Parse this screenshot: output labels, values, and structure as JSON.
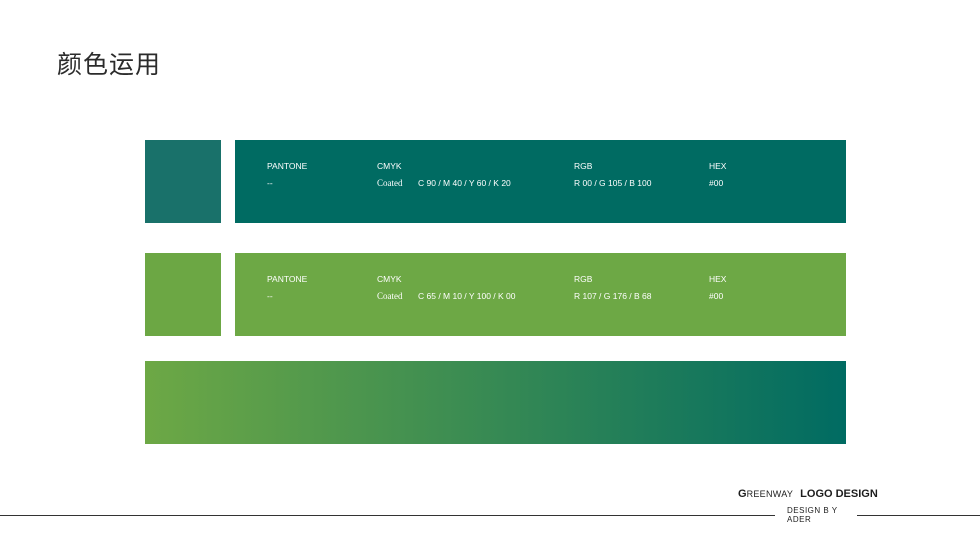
{
  "title": "颜色运用",
  "colors": {
    "teal": "#006B62",
    "teal_swatch": "#19716A",
    "green": "#6DA845",
    "green_swatch": "#6CA744"
  },
  "swatches": [
    {
      "pantone_label": "PANTONE",
      "pantone_value": "--",
      "cmyk_label": "CMYK",
      "cmyk_coated": "Coated",
      "cmyk_value": "C 90 / M 40 / Y 60 / K 20",
      "rgb_label": "RGB",
      "rgb_value": "R 00 / G 105 / B 100",
      "hex_label": "HEX",
      "hex_value": "#00"
    },
    {
      "pantone_label": "PANTONE",
      "pantone_value": "--",
      "cmyk_label": "CMYK",
      "cmyk_coated": "Coated",
      "cmyk_value": "C 65 / M 10 / Y 100 / K 00",
      "rgb_label": "RGB",
      "rgb_value": "R 107 / G 176 / B 68",
      "hex_label": "HEX",
      "hex_value": "#00"
    }
  ],
  "footer": {
    "brand_first": "G",
    "brand_rest": "REENWAY",
    "brand_logo": "LOGO DESIGN",
    "credit_line1": "DESIGN B Y",
    "credit_line2": "ADER"
  }
}
